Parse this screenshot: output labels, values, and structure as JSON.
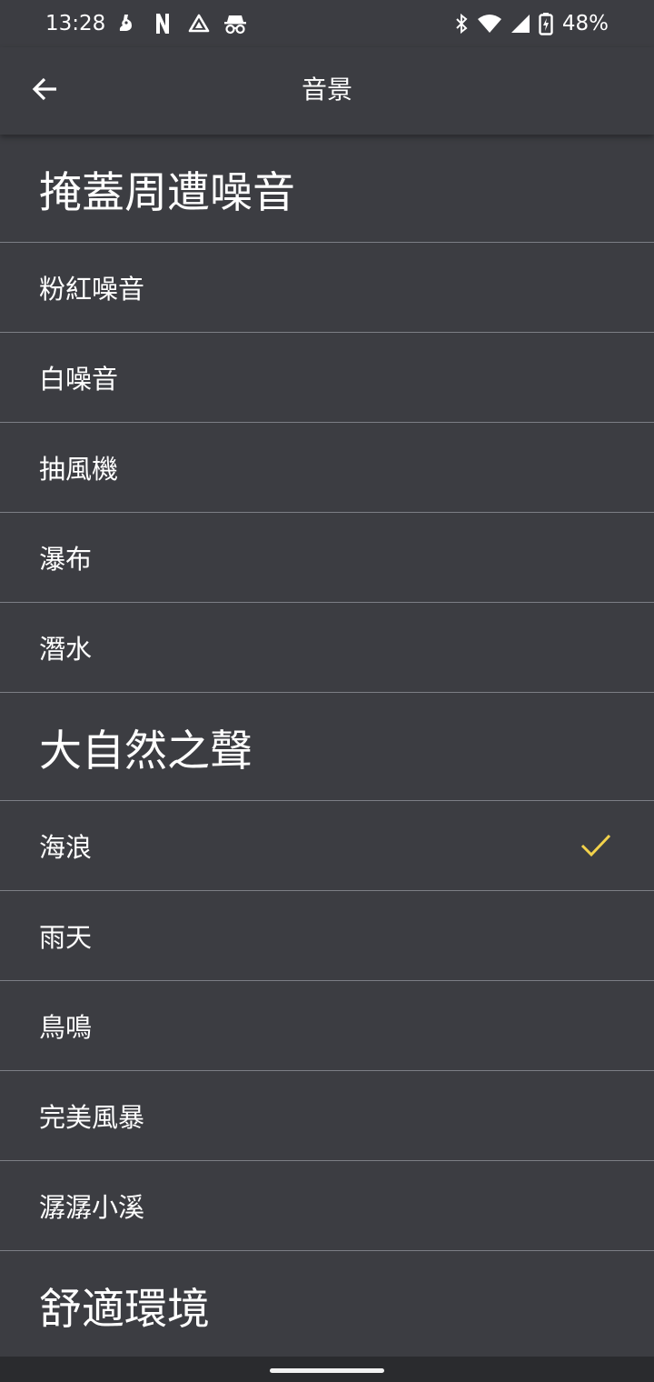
{
  "status_bar": {
    "time": "13:28",
    "left_icons": [
      "pokemon-icon",
      "netflix-icon",
      "drive-icon",
      "incognito-icon"
    ],
    "right_icons": [
      "bluetooth-icon",
      "wifi-icon",
      "signal-icon",
      "battery-charging-icon"
    ],
    "battery": "48%"
  },
  "app_bar": {
    "title": "音景",
    "back_icon": "arrow-left-icon"
  },
  "colors": {
    "background": "#3c3d42",
    "divider": "#7c7e85",
    "accent_check": "#f2d24b",
    "text": "#ffffff"
  },
  "sections": [
    {
      "title": "掩蓋周遭噪音",
      "items": [
        {
          "label": "粉紅噪音",
          "selected": false
        },
        {
          "label": "白噪音",
          "selected": false
        },
        {
          "label": "抽風機",
          "selected": false
        },
        {
          "label": "瀑布",
          "selected": false
        },
        {
          "label": "潛水",
          "selected": false
        }
      ]
    },
    {
      "title": "大自然之聲",
      "items": [
        {
          "label": "海浪",
          "selected": true
        },
        {
          "label": "雨天",
          "selected": false
        },
        {
          "label": "鳥鳴",
          "selected": false
        },
        {
          "label": "完美風暴",
          "selected": false
        },
        {
          "label": "潺潺小溪",
          "selected": false
        }
      ]
    },
    {
      "title": "舒適環境",
      "items": []
    }
  ]
}
